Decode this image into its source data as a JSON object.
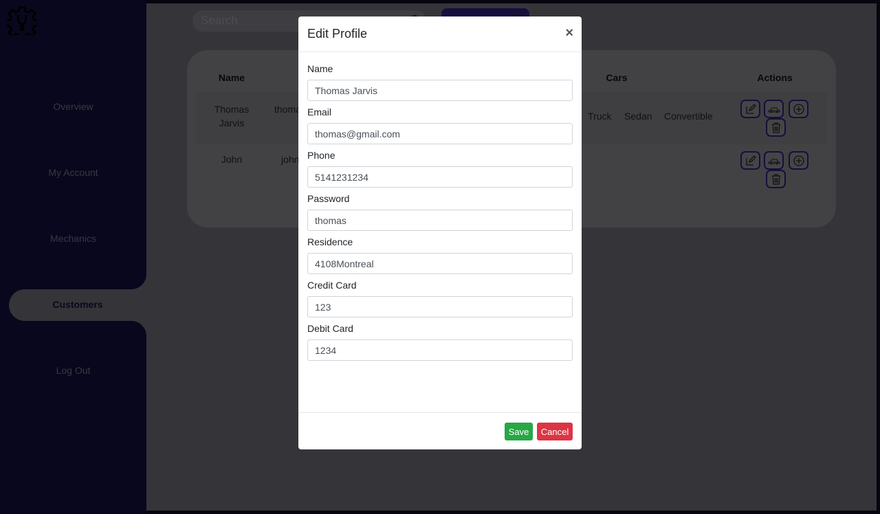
{
  "sidebar": {
    "logo_icon": "gear-wrench-icon",
    "items": [
      {
        "label": "Overview",
        "active": false
      },
      {
        "label": "My Account",
        "active": false
      },
      {
        "label": "Mechanics",
        "active": false
      },
      {
        "label": "Customers",
        "active": true
      },
      {
        "label": "Log Out",
        "active": false
      }
    ]
  },
  "toolbar": {
    "search_placeholder": "Search",
    "search_icon": "search-icon",
    "add_button_icon": "plus-circle-icon"
  },
  "table": {
    "headers": {
      "name": "Name",
      "cars": "Cars",
      "actions": "Actions"
    },
    "rows": [
      {
        "name_line1": "Thomas",
        "name_line2": "Jarvis",
        "email": "thoma",
        "cars": [
          "Truck",
          "Sedan",
          "Convertible"
        ]
      },
      {
        "name_line1": "John",
        "name_line2": "",
        "email": "john",
        "cars": []
      }
    ],
    "action_icons": [
      "edit-icon",
      "add-car-icon",
      "plus-circle-icon",
      "trash-icon"
    ]
  },
  "modal": {
    "title": "Edit Profile",
    "close_label": "×",
    "fields": [
      {
        "label": "Name",
        "value": "Thomas Jarvis"
      },
      {
        "label": "Email",
        "value": "thomas@gmail.com"
      },
      {
        "label": "Phone",
        "value": "5141231234"
      },
      {
        "label": "Password",
        "value": "thomas"
      },
      {
        "label": "Residence",
        "value": "4108Montreal"
      },
      {
        "label": "Credit Card",
        "value": "123"
      },
      {
        "label": "Debit Card",
        "value": "1234"
      }
    ],
    "save_label": "Save",
    "cancel_label": "Cancel"
  },
  "colors": {
    "sidebar_bg": "#130f3a",
    "accent": "#2a1f7a",
    "save": "#28a745",
    "cancel": "#dc3545"
  }
}
